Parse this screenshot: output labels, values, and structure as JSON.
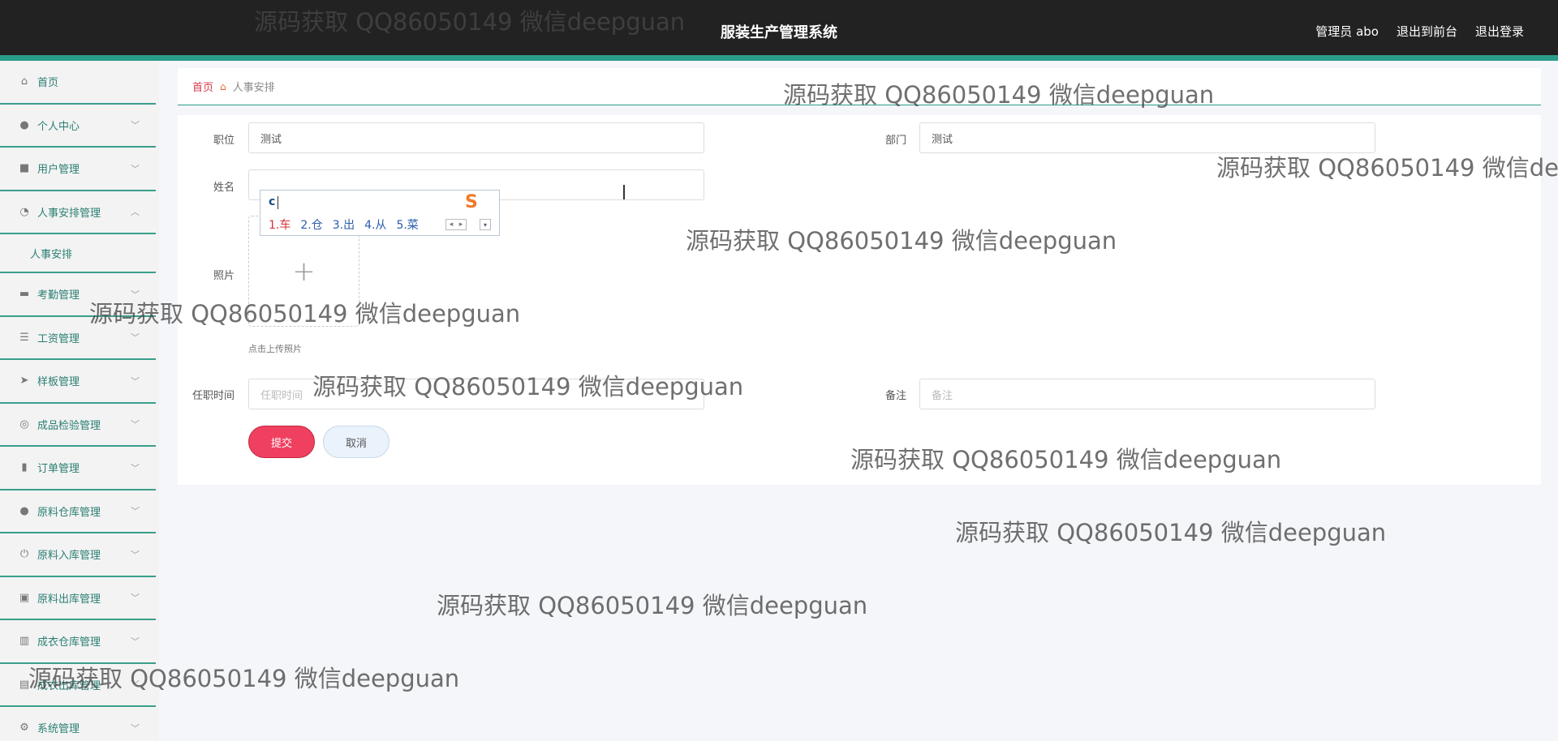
{
  "header": {
    "title": "服装生产管理系统",
    "links": [
      "管理员 abo",
      "退出到前台",
      "退出登录"
    ]
  },
  "sidebar": {
    "items": [
      {
        "label": "首页",
        "icon": "home-icon",
        "glyph": "⌂",
        "chevron": ""
      },
      {
        "label": "个人中心",
        "icon": "user-icon",
        "glyph": "●",
        "chevron": "﹀"
      },
      {
        "label": "用户管理",
        "icon": "users-icon",
        "glyph": "■",
        "chevron": "﹀"
      },
      {
        "label": "人事安排管理",
        "icon": "dashboard-icon",
        "glyph": "◔",
        "chevron": "︿"
      },
      {
        "label": "人事安排",
        "sub": true
      },
      {
        "label": "考勤管理",
        "icon": "chat-icon",
        "glyph": "▬",
        "chevron": "﹀"
      },
      {
        "label": "工资管理",
        "icon": "list-icon",
        "glyph": "☰",
        "chevron": "﹀"
      },
      {
        "label": "样板管理",
        "icon": "send-icon",
        "glyph": "➤",
        "chevron": "﹀"
      },
      {
        "label": "成品检验管理",
        "icon": "settings-icon",
        "glyph": "◎",
        "chevron": "﹀"
      },
      {
        "label": "订单管理",
        "icon": "clipboard-icon",
        "glyph": "▮",
        "chevron": "﹀"
      },
      {
        "label": "原料仓库管理",
        "icon": "person-icon",
        "glyph": "●",
        "chevron": "﹀"
      },
      {
        "label": "原料入库管理",
        "icon": "power-icon",
        "glyph": "⏻",
        "chevron": "﹀"
      },
      {
        "label": "原料出库管理",
        "icon": "archive-icon",
        "glyph": "▣",
        "chevron": "﹀"
      },
      {
        "label": "成衣仓库管理",
        "icon": "chart-icon",
        "glyph": "▥",
        "chevron": "﹀"
      },
      {
        "label": "成衣出库管理",
        "icon": "document-icon",
        "glyph": "▤",
        "chevron": "﹀"
      },
      {
        "label": "系统管理",
        "icon": "gear-icon",
        "glyph": "⚙",
        "chevron": "﹀"
      }
    ]
  },
  "breadcrumb": {
    "home": "首页",
    "current": "人事安排"
  },
  "form": {
    "position_label": "职位",
    "position_value": "测试",
    "department_label": "部门",
    "department_value": "测试",
    "name_label": "姓名",
    "name_value": "",
    "photo_label": "照片",
    "upload_tip": "点击上传照片",
    "hire_date_label": "任职时间",
    "hire_date_placeholder": "任职时间",
    "remark_label": "备注",
    "remark_placeholder": "备注",
    "submit_label": "提交",
    "cancel_label": "取消"
  },
  "ime": {
    "typed": "c",
    "candidates": [
      "1.车",
      "2.仓",
      "3.出",
      "4.从",
      "5.菜"
    ]
  },
  "watermark": "源码获取 QQ86050149 微信deepguan"
}
